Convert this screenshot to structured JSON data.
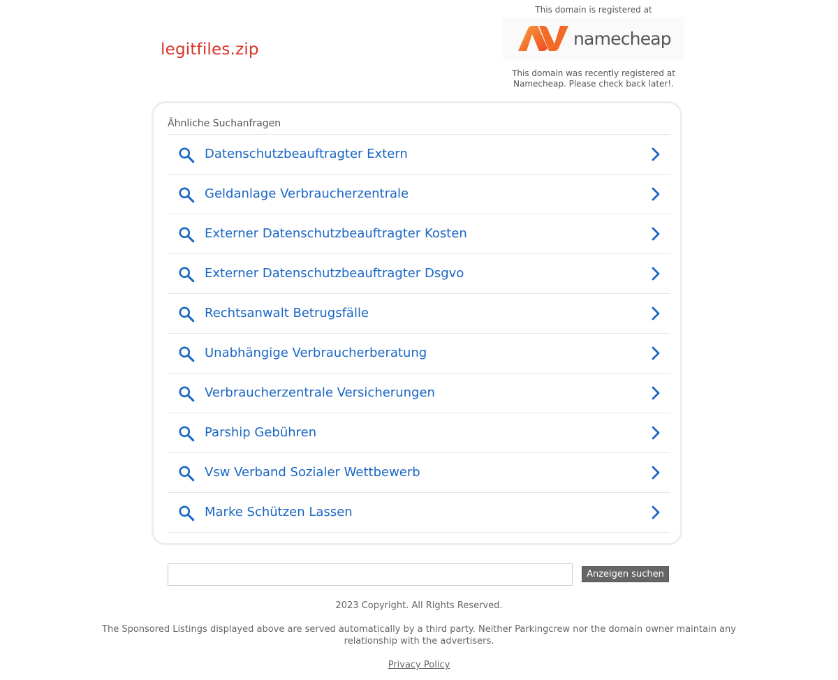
{
  "domain": "legitfiles.zip",
  "registrar": {
    "top_text": "This domain is registered at",
    "logo_text": "namecheap",
    "note": "This domain was recently registered at Namecheap. Please check back later!."
  },
  "related": {
    "heading": "Ähnliche Suchanfragen",
    "items": [
      {
        "label": "Datenschutzbeauftragter Extern"
      },
      {
        "label": "Geldanlage Verbraucherzentrale"
      },
      {
        "label": "Externer Datenschutzbeauftragter Kosten"
      },
      {
        "label": "Externer Datenschutzbeauftragter Dsgvo"
      },
      {
        "label": "Rechtsanwalt Betrugsfälle"
      },
      {
        "label": "Unabhängige Verbraucherberatung"
      },
      {
        "label": "Verbraucherzentrale Versicherungen"
      },
      {
        "label": "Parship Gebühren"
      },
      {
        "label": "Vsw Verband Sozialer Wettbewerb"
      },
      {
        "label": "Marke Schützen Lassen"
      }
    ]
  },
  "search": {
    "value": "",
    "button_label": "Anzeigen suchen"
  },
  "footer": {
    "copyright": "2023 Copyright. All Rights Reserved.",
    "disclaimer": "The Sponsored Listings displayed above are served automatically by a third party. Neither Parkingcrew nor the domain owner maintain any relationship with the advertisers.",
    "privacy": "Privacy Policy"
  },
  "colors": {
    "domain_title": "#d8352a",
    "link": "#1a66c4",
    "logo_orange": "#f26a25"
  },
  "icons": {
    "search": "search-icon",
    "chevron": "chevron-right-icon",
    "logo": "namecheap-logo-icon"
  }
}
